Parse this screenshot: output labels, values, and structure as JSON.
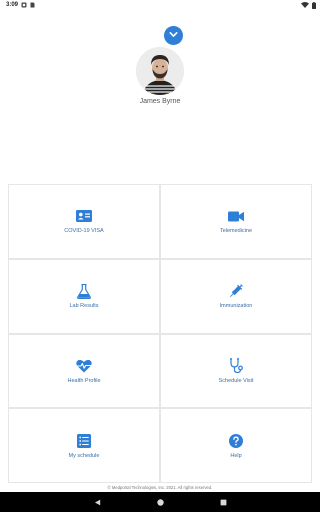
{
  "status_bar": {
    "time": "3:09",
    "icons": [
      "notification-icon",
      "sim-icon",
      "wifi-icon",
      "battery-icon"
    ]
  },
  "profile": {
    "name": "James Byrne",
    "expand_icon": "chevron-down-icon",
    "accent_color": "#2f7fd6"
  },
  "menu": {
    "items": [
      {
        "label": "COVID-19 VISA",
        "icon": "id-card-icon"
      },
      {
        "label": "Telemedicine",
        "icon": "video-camera-icon"
      },
      {
        "label": "Lab Results",
        "icon": "flask-icon"
      },
      {
        "label": "Immunization",
        "icon": "syringe-icon"
      },
      {
        "label": "Health Profile",
        "icon": "heart-pulse-icon"
      },
      {
        "label": "Schedule Visit",
        "icon": "stethoscope-icon"
      },
      {
        "label": "My schedule",
        "icon": "list-icon"
      },
      {
        "label": "Help",
        "icon": "help-icon"
      }
    ],
    "icon_color": "#2f7fd6",
    "label_color": "#3a6ea5"
  },
  "footer": {
    "copyright": "© Medportal Technologies, Inc. 2021. All rights reserved."
  },
  "nav_bar": {
    "buttons": [
      "back-icon",
      "home-icon",
      "recents-icon"
    ]
  }
}
